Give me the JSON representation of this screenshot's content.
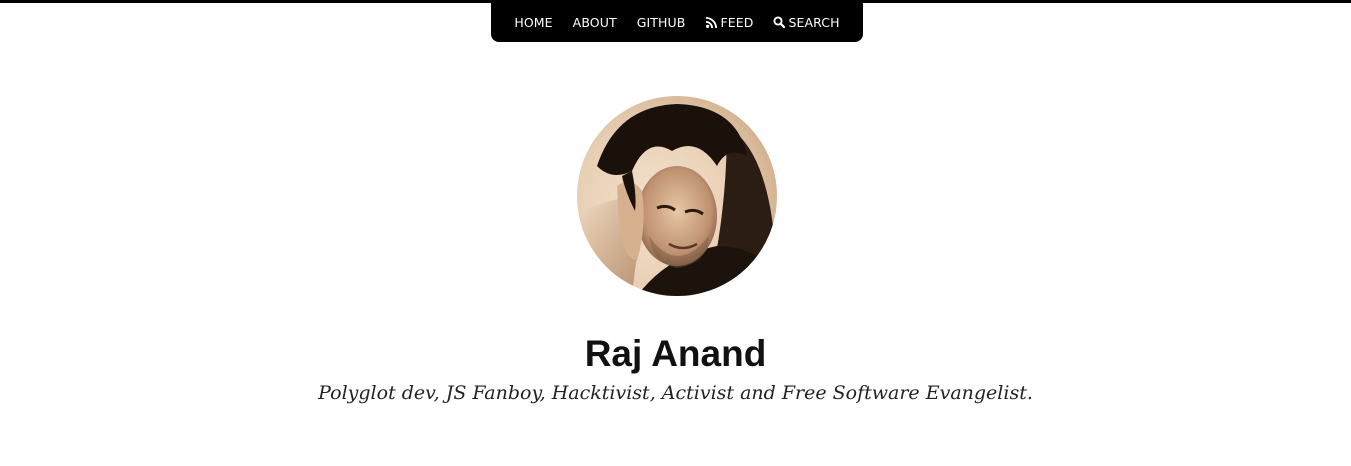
{
  "nav": {
    "items": [
      {
        "label": "HOME",
        "icon": ""
      },
      {
        "label": "ABOUT",
        "icon": ""
      },
      {
        "label": "GITHUB",
        "icon": ""
      },
      {
        "label": "FEED",
        "icon": "rss-icon"
      },
      {
        "label": "SEARCH",
        "icon": "search-icon"
      }
    ]
  },
  "profile": {
    "name": "Raj Anand",
    "tagline": "Polyglot dev, JS Fanboy, Hacktivist, Activist and Free Software Evangelist."
  },
  "colors": {
    "nav_background": "#000000",
    "nav_text": "#ffffff",
    "page_background": "#ffffff",
    "title_text": "#111111"
  }
}
